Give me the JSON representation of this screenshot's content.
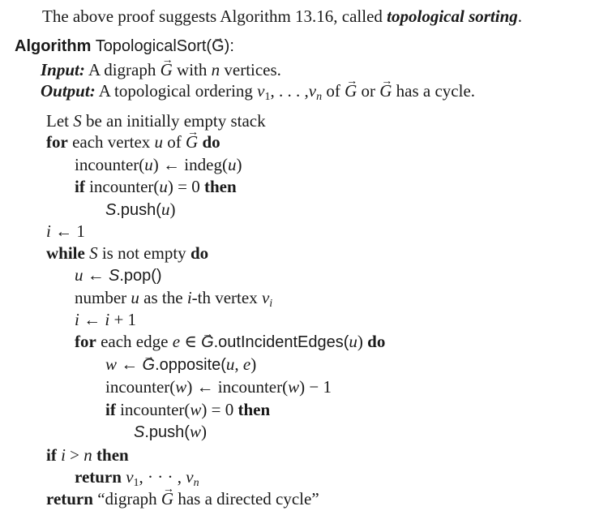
{
  "intro": {
    "prefix": "The above proof suggests Algorithm 13.16, called ",
    "term": "topological sorting",
    "suffix": "."
  },
  "header": {
    "keyword": "Algorithm",
    "name": "TopologicalSort(",
    "G": "G",
    "close": "):"
  },
  "input": {
    "label": "Input:",
    "text1": " A digraph ",
    "G": "G",
    "text2": " with ",
    "n": "n",
    "text3": " vertices."
  },
  "output": {
    "label": "Output:",
    "text1": " A topological ordering ",
    "v1": "v",
    "sub1": "1",
    "dots": ", . . . ,",
    "vn": "v",
    "subn": "n",
    "text2": " of ",
    "G1": "G",
    "text3": " or ",
    "G2": "G",
    "text4": " has a cycle."
  },
  "lines": {
    "l1": {
      "a": "Let ",
      "S": "S",
      "b": " be an initially empty stack"
    },
    "l2": {
      "for": "for",
      "a": " each vertex ",
      "u": "u",
      "b": " of ",
      "G": "G",
      "do": " do"
    },
    "l3": {
      "a": "incounter(",
      "u": "u",
      "b": ") ← indeg(",
      "u2": "u",
      "c": ")"
    },
    "l4": {
      "if": "if",
      "a": " incounter(",
      "u": "u",
      "b": ") = 0 ",
      "then": "then"
    },
    "l5": {
      "S": "S",
      "a": ".push(",
      "u": "u",
      "b": ")"
    },
    "l6": {
      "i": "i",
      "a": " ← 1"
    },
    "l7": {
      "while": "while",
      "S": " S",
      "a": " is not empty ",
      "do": "do"
    },
    "l8": {
      "u": "u",
      "a": " ← ",
      "S": "S",
      "b": ".pop()"
    },
    "l9": {
      "a": "number ",
      "u": "u",
      "b": " as the ",
      "i": "i",
      "c": "-th vertex ",
      "v": "v",
      "sub": "i"
    },
    "l10": {
      "i": "i",
      "a": " ← ",
      "i2": "i",
      "b": " + 1"
    },
    "l11": {
      "for": "for",
      "a": " each edge ",
      "e": "e",
      "b": " ∈ ",
      "G": "G",
      "c": ".outIncidentEdges(",
      "u": "u",
      "d": ") ",
      "do": "do"
    },
    "l12": {
      "w": "w",
      "a": " ← ",
      "G": "G",
      "b": ".opposite(",
      "u": "u",
      "c": ", ",
      "e": "e",
      "d": ")"
    },
    "l13": {
      "a": "incounter(",
      "w": "w",
      "b": ") ← incounter(",
      "w2": "w",
      "c": ") − 1"
    },
    "l14": {
      "if": "if",
      "a": " incounter(",
      "w": "w",
      "b": ") = 0 ",
      "then": "then"
    },
    "l15": {
      "S": "S",
      "a": ".push(",
      "w": "w",
      "b": ")"
    },
    "l16": {
      "if": "if",
      "i": " i",
      "a": " > ",
      "n": "n",
      "then": " then"
    },
    "l17": {
      "return": "return",
      "v1": " v",
      "sub1": "1",
      "a": ", · · · , ",
      "vn": "v",
      "subn": "n"
    },
    "l18": {
      "return": "return",
      "a": " “digraph ",
      "G": "G",
      "b": " has a directed cycle”"
    }
  }
}
